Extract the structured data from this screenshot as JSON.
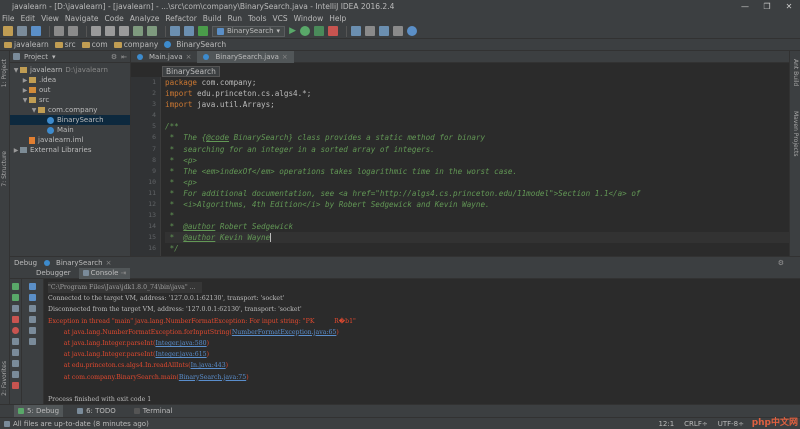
{
  "window": {
    "title": "javalearn - [D:\\javalearn] - [javalearn] - ...\\src\\com\\company\\BinarySearch.java - IntelliJ IDEA 2016.2.4",
    "controls": [
      "—",
      "❐",
      "✕"
    ]
  },
  "menu": [
    "File",
    "Edit",
    "View",
    "Navigate",
    "Code",
    "Analyze",
    "Refactor",
    "Build",
    "Run",
    "Tools",
    "VCS",
    "Window",
    "Help"
  ],
  "toolbar": {
    "run_config": "BinarySearch"
  },
  "nav": {
    "crumbs": [
      "javalearn",
      "src",
      "com",
      "company",
      "BinarySearch"
    ]
  },
  "side_tabs": {
    "project": "1: Project",
    "structure": "7: Structure",
    "favorites": "2: Favorites",
    "ant_build": "Ant Build",
    "maven": "Maven Projects"
  },
  "project_panel": {
    "header": "Project",
    "tree": [
      {
        "label": "javalearn",
        "extra": "D:\\javalearn",
        "indent": 0,
        "kind": "folder",
        "tri": "▼"
      },
      {
        "label": ".idea",
        "extra": "",
        "indent": 1,
        "kind": "folder",
        "tri": "▶"
      },
      {
        "label": "out",
        "extra": "",
        "indent": 1,
        "kind": "folder-orange",
        "tri": "▶"
      },
      {
        "label": "src",
        "extra": "",
        "indent": 1,
        "kind": "folder",
        "tri": "▼"
      },
      {
        "label": "com.company",
        "extra": "",
        "indent": 2,
        "kind": "package",
        "tri": "▼"
      },
      {
        "label": "BinarySearch",
        "extra": "",
        "indent": 3,
        "kind": "class",
        "tri": "",
        "selected": true
      },
      {
        "label": "Main",
        "extra": "",
        "indent": 3,
        "kind": "class",
        "tri": ""
      },
      {
        "label": "javalearn.iml",
        "extra": "",
        "indent": 1,
        "kind": "xml",
        "tri": ""
      },
      {
        "label": "External Libraries",
        "extra": "",
        "indent": 0,
        "kind": "lib",
        "tri": "▶"
      }
    ]
  },
  "editor": {
    "tabs": [
      {
        "label": "Main.java",
        "active": false
      },
      {
        "label": "BinarySearch.java",
        "active": true
      }
    ],
    "breadcrumb_popup": "BinarySearch",
    "line_numbers": [
      "1",
      "2",
      "3",
      "4",
      "5",
      "6",
      "7",
      "8",
      "9",
      "10",
      "11",
      "12",
      "13",
      "14",
      "15",
      "16",
      "17"
    ]
  },
  "debug": {
    "title": "Debug",
    "config": "BinarySearch",
    "tabs": [
      "Debugger",
      "Console"
    ],
    "console": [
      "\"C:\\Program Files\\Java\\jdk1.8.0_74\\bin\\java\" ...",
      "Connected to the target VM, address: '127.0.0.1:62130', transport: 'socket'",
      "Disconnected from the target VM, address: '127.0.0.1:62130', transport: 'socket'",
      "Exception in thread \"main\" java.lang.NumberFormatException: For input string: \"PK          R�b1\"",
      "at java.lang.NumberFormatException.forInputString(",
      "NumberFormatException.java:65",
      "at java.lang.Integer.parseInt(",
      "Integer.java:580",
      "at java.lang.Integer.parseInt(",
      "Integer.java:615",
      "at edu.princeton.cs.algs4.In.readAllInts(",
      "In.java:443",
      "at com.company.BinarySearch.main(",
      "BinarySearch.java:75",
      "Process finished with exit code 1"
    ]
  },
  "bottom_tabs": [
    "5: Debug",
    "6: TODO",
    "Terminal"
  ],
  "status": {
    "message": "All files are up-to-date (8 minutes ago)",
    "position": "12:1",
    "crlf": "CRLF÷",
    "encoding": "UTF-8÷"
  },
  "watermark": "php中文网",
  "colors": {
    "keyword": "#cc7832",
    "comment": "#629755",
    "error": "#e0492f",
    "link": "#5a8ecc"
  }
}
